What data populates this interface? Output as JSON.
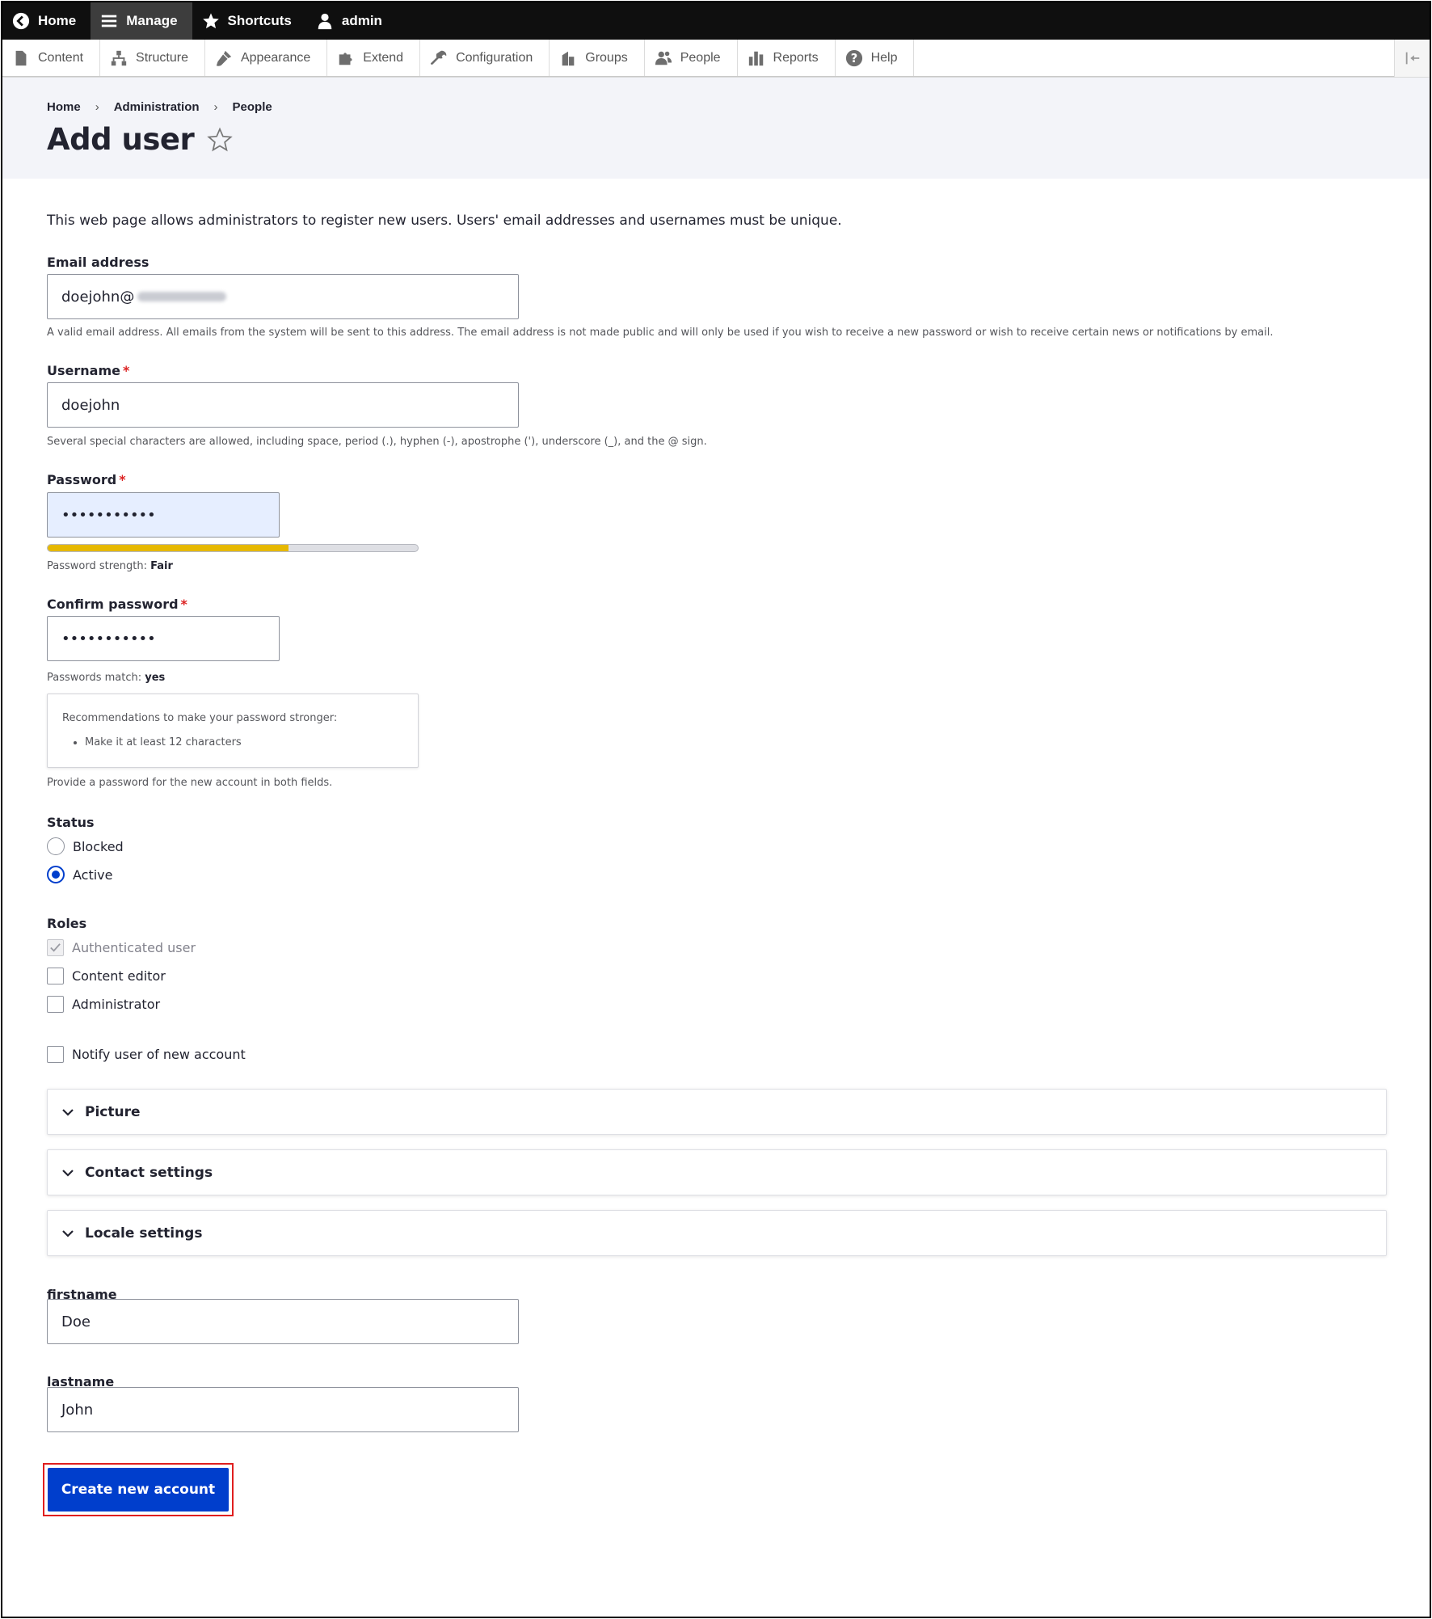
{
  "toolbar": {
    "home": "Home",
    "manage": "Manage",
    "shortcuts": "Shortcuts",
    "user": "admin"
  },
  "tray": {
    "items": [
      "Content",
      "Structure",
      "Appearance",
      "Extend",
      "Configuration",
      "Groups",
      "People",
      "Reports",
      "Help"
    ]
  },
  "breadcrumb": [
    "Home",
    "Administration",
    "People"
  ],
  "breadcrumb_separator": "›",
  "page_title": "Add user",
  "intro": "This web page allows administrators to register new users. Users' email addresses and usernames must be unique.",
  "email": {
    "label": "Email address",
    "value": "doejohn@",
    "description": "A valid email address. All emails from the system will be sent to this address. The email address is not made public and will only be used if you wish to receive a new password or wish to receive certain news or notifications by email."
  },
  "username": {
    "label": "Username",
    "required_mark": "*",
    "value": "doejohn",
    "description": "Several special characters are allowed, including space, period (.), hyphen (-), apostrophe ('), underscore (_), and the @ sign."
  },
  "password": {
    "label": "Password",
    "required_mark": "*",
    "value": "•••••••••••",
    "strength_label": "Password strength:",
    "strength_value": "Fair",
    "strength_fraction": 0.65
  },
  "confirm_password": {
    "label": "Confirm password",
    "required_mark": "*",
    "value": "•••••••••••",
    "match_label": "Passwords match:",
    "match_value": "yes"
  },
  "recommendations": {
    "title": "Recommendations to make your password stronger:",
    "items": [
      "Make it at least 12 characters"
    ]
  },
  "password_help": "Provide a password for the new account in both fields.",
  "status": {
    "label": "Status",
    "options": [
      "Blocked",
      "Active"
    ],
    "selected": "Active"
  },
  "roles": {
    "label": "Roles",
    "options": [
      "Authenticated user",
      "Content editor",
      "Administrator"
    ]
  },
  "notify": "Notify user of new account",
  "sections": [
    "Picture",
    "Contact settings",
    "Locale settings"
  ],
  "firstname": {
    "label": "firstname",
    "value": "Doe"
  },
  "lastname": {
    "label": "lastname",
    "value": "John"
  },
  "submit": "Create new account",
  "colors": {
    "toolbar_bg": "#0f0f0f",
    "primary": "#003ecc",
    "required": "#dc2323",
    "strength_fill": "#e6b800",
    "highlight_outline": "#e01e1e"
  }
}
